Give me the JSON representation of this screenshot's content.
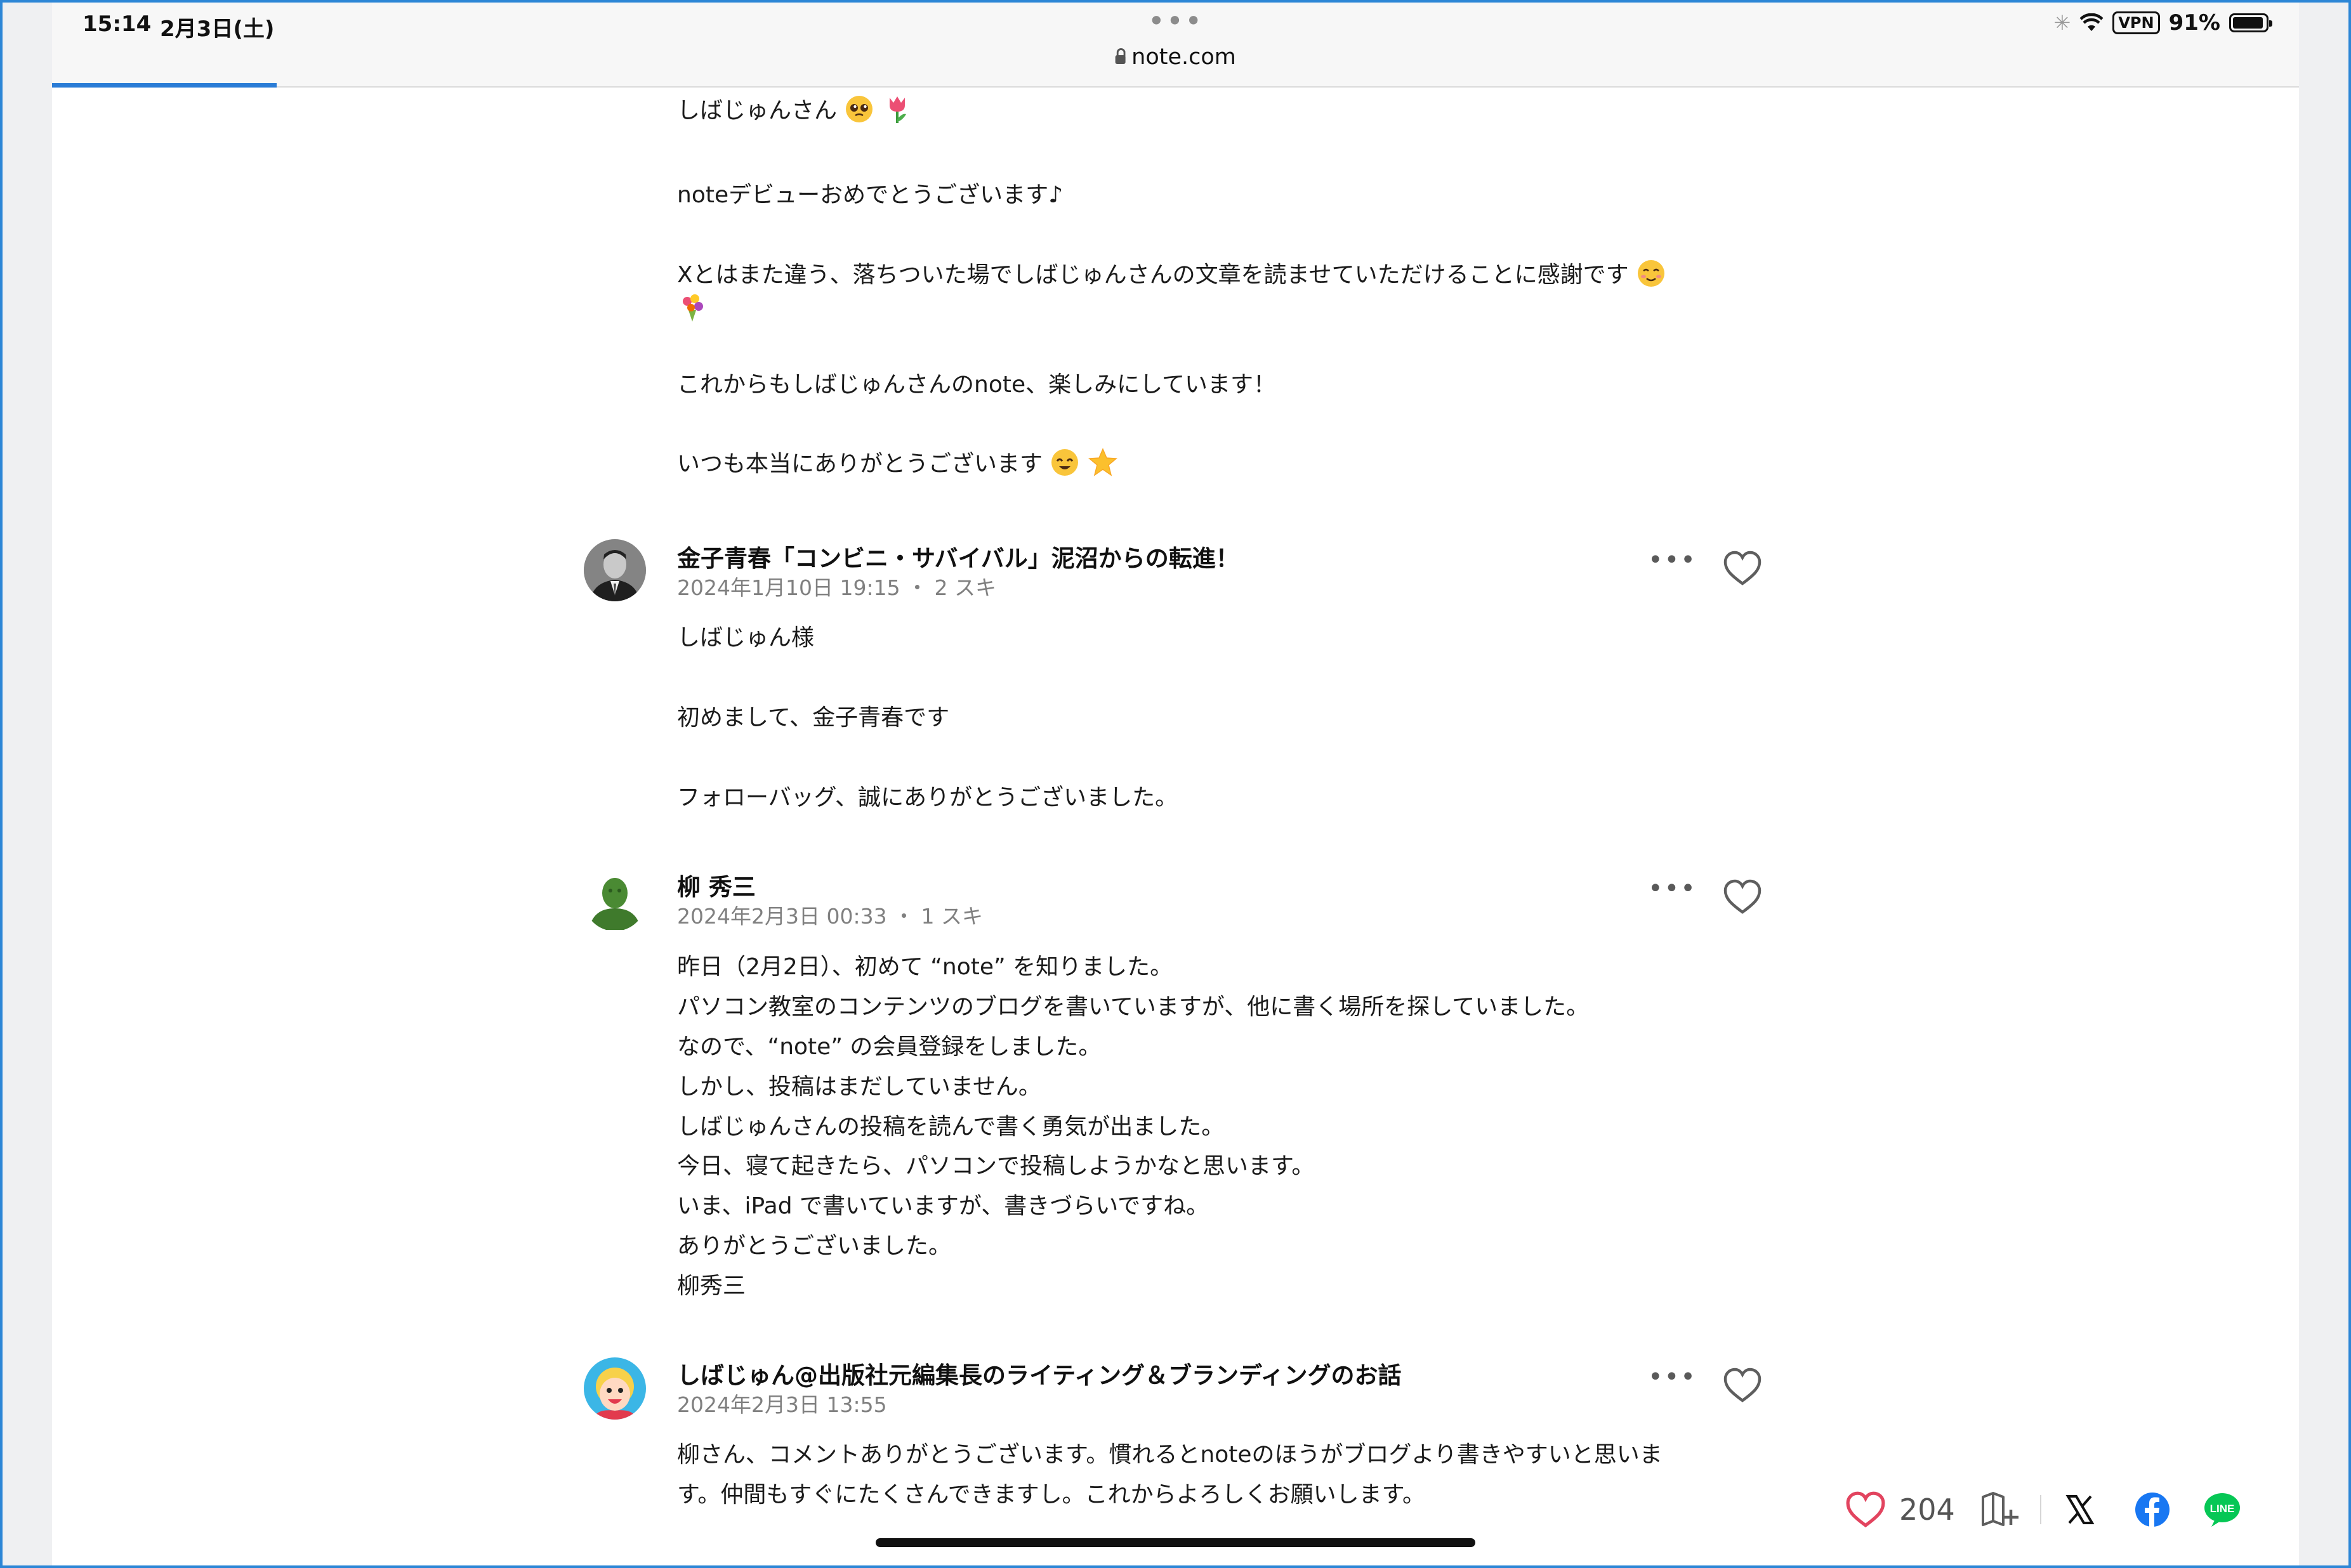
{
  "status_bar": {
    "time": "15:14",
    "date": "2月3日(土)",
    "battery": "91%",
    "vpn": "VPN",
    "menu_dots": "•••"
  },
  "address_bar": {
    "url": "note.com"
  },
  "thread": {
    "first_comment_body": [
      "しばじゅんさん",
      "noteデビューおめでとうございます♪",
      "Xとはまた違う、落ちついた場でしばじゅんさんの文章を読ませていただけることに感謝です",
      "これからもしばじゅんさんのnote、楽しみにしています！",
      "いつも本当にありがとうございます"
    ],
    "comments": [
      {
        "name": "金子青春「コンビニ・サバイバル」泥沼からの転進！",
        "meta": "2024年1月10日 19:15 ・ 2 スキ",
        "body": [
          "しばじゅん様",
          "初めまして、金子青春です",
          "フォローバッグ、誠にありがとうございました。"
        ]
      },
      {
        "name": "柳 秀三",
        "meta": "2024年2月3日 00:33 ・ 1 スキ",
        "body": [
          "昨日（2月2日）、初めて “note” を知りました。",
          "パソコン教室のコンテンツのブログを書いていますが、他に書く場所を探していました。",
          "なので、“note” の会員登録をしました。",
          "しかし、投稿はまだしていません。",
          "しばじゅんさんの投稿を読んで書く勇気が出ました。",
          "今日、寝て起きたら、パソコンで投稿しようかなと思います。",
          "いま、iPad で書いていますが、書きづらいですね。",
          "ありがとうございました。",
          "柳秀三"
        ]
      },
      {
        "name": "しばじゅん@出版社元編集長のライティング＆ブランディングのお話",
        "meta": "2024年2月3日 13:55",
        "body": [
          "柳さん、コメントありがとうございます。慣れるとnoteのほうがブログより書きやすいと思いま",
          "す。仲間もすぐにたくさんできますし。これからよろしくお願いします。"
        ]
      }
    ],
    "more_label": "•••"
  },
  "action_bar": {
    "likes": "204"
  },
  "colors": {
    "accent": "#2a7cd6",
    "like": "#e2445f",
    "facebook": "#1877f2",
    "line": "#06c755"
  }
}
